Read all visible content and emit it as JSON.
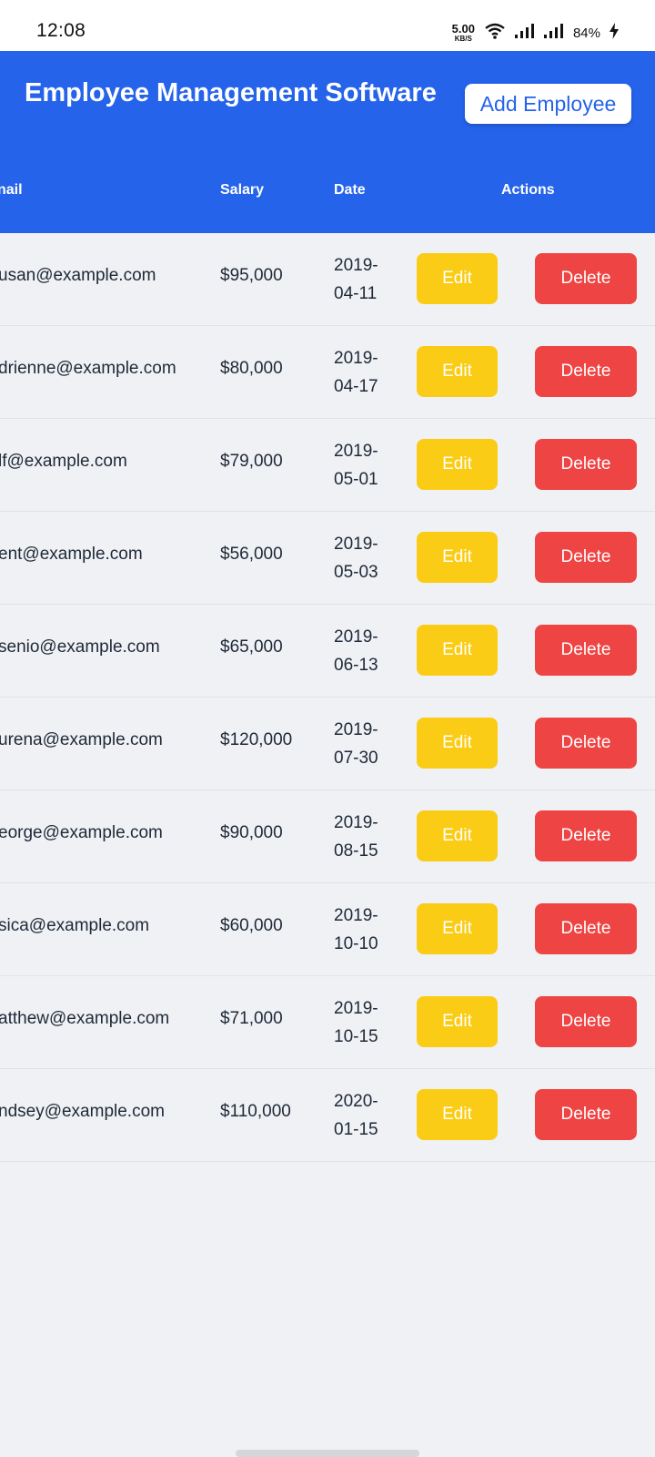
{
  "status_bar": {
    "time": "12:08",
    "net_speed_value": "5.00",
    "net_speed_unit": "KB/S",
    "battery": "84%"
  },
  "header": {
    "title": "Employee Management Software",
    "add_button": "Add Employee",
    "columns": {
      "email": "nail",
      "salary": "Salary",
      "date": "Date",
      "actions": "Actions"
    }
  },
  "rows": [
    {
      "email": "usan@example.com",
      "salary": "$95,000",
      "date": "2019-04-11",
      "edit": "Edit",
      "delete": "Delete"
    },
    {
      "email": "drienne@example.com",
      "salary": "$80,000",
      "date": "2019-04-17",
      "edit": "Edit",
      "delete": "Delete"
    },
    {
      "email": "lf@example.com",
      "salary": "$79,000",
      "date": "2019-05-01",
      "edit": "Edit",
      "delete": "Delete"
    },
    {
      "email": "ent@example.com",
      "salary": "$56,000",
      "date": "2019-05-03",
      "edit": "Edit",
      "delete": "Delete"
    },
    {
      "email": "senio@example.com",
      "salary": "$65,000",
      "date": "2019-06-13",
      "edit": "Edit",
      "delete": "Delete"
    },
    {
      "email": "urena@example.com",
      "salary": "$120,000",
      "date": "2019-07-30",
      "edit": "Edit",
      "delete": "Delete"
    },
    {
      "email": "eorge@example.com",
      "salary": "$90,000",
      "date": "2019-08-15",
      "edit": "Edit",
      "delete": "Delete"
    },
    {
      "email": "sica@example.com",
      "salary": "$60,000",
      "date": "2019-10-10",
      "edit": "Edit",
      "delete": "Delete"
    },
    {
      "email": "atthew@example.com",
      "salary": "$71,000",
      "date": "2019-10-15",
      "edit": "Edit",
      "delete": "Delete"
    },
    {
      "email": "ndsey@example.com",
      "salary": "$110,000",
      "date": "2020-01-15",
      "edit": "Edit",
      "delete": "Delete"
    }
  ],
  "colors": {
    "primary": "#2563eb",
    "edit": "#facc15",
    "delete": "#ef4444",
    "background": "#eff1f5"
  },
  "icons": [
    "wifi-icon",
    "cell-signal-icon",
    "cell-signal-2-icon",
    "charging-bolt-icon"
  ]
}
